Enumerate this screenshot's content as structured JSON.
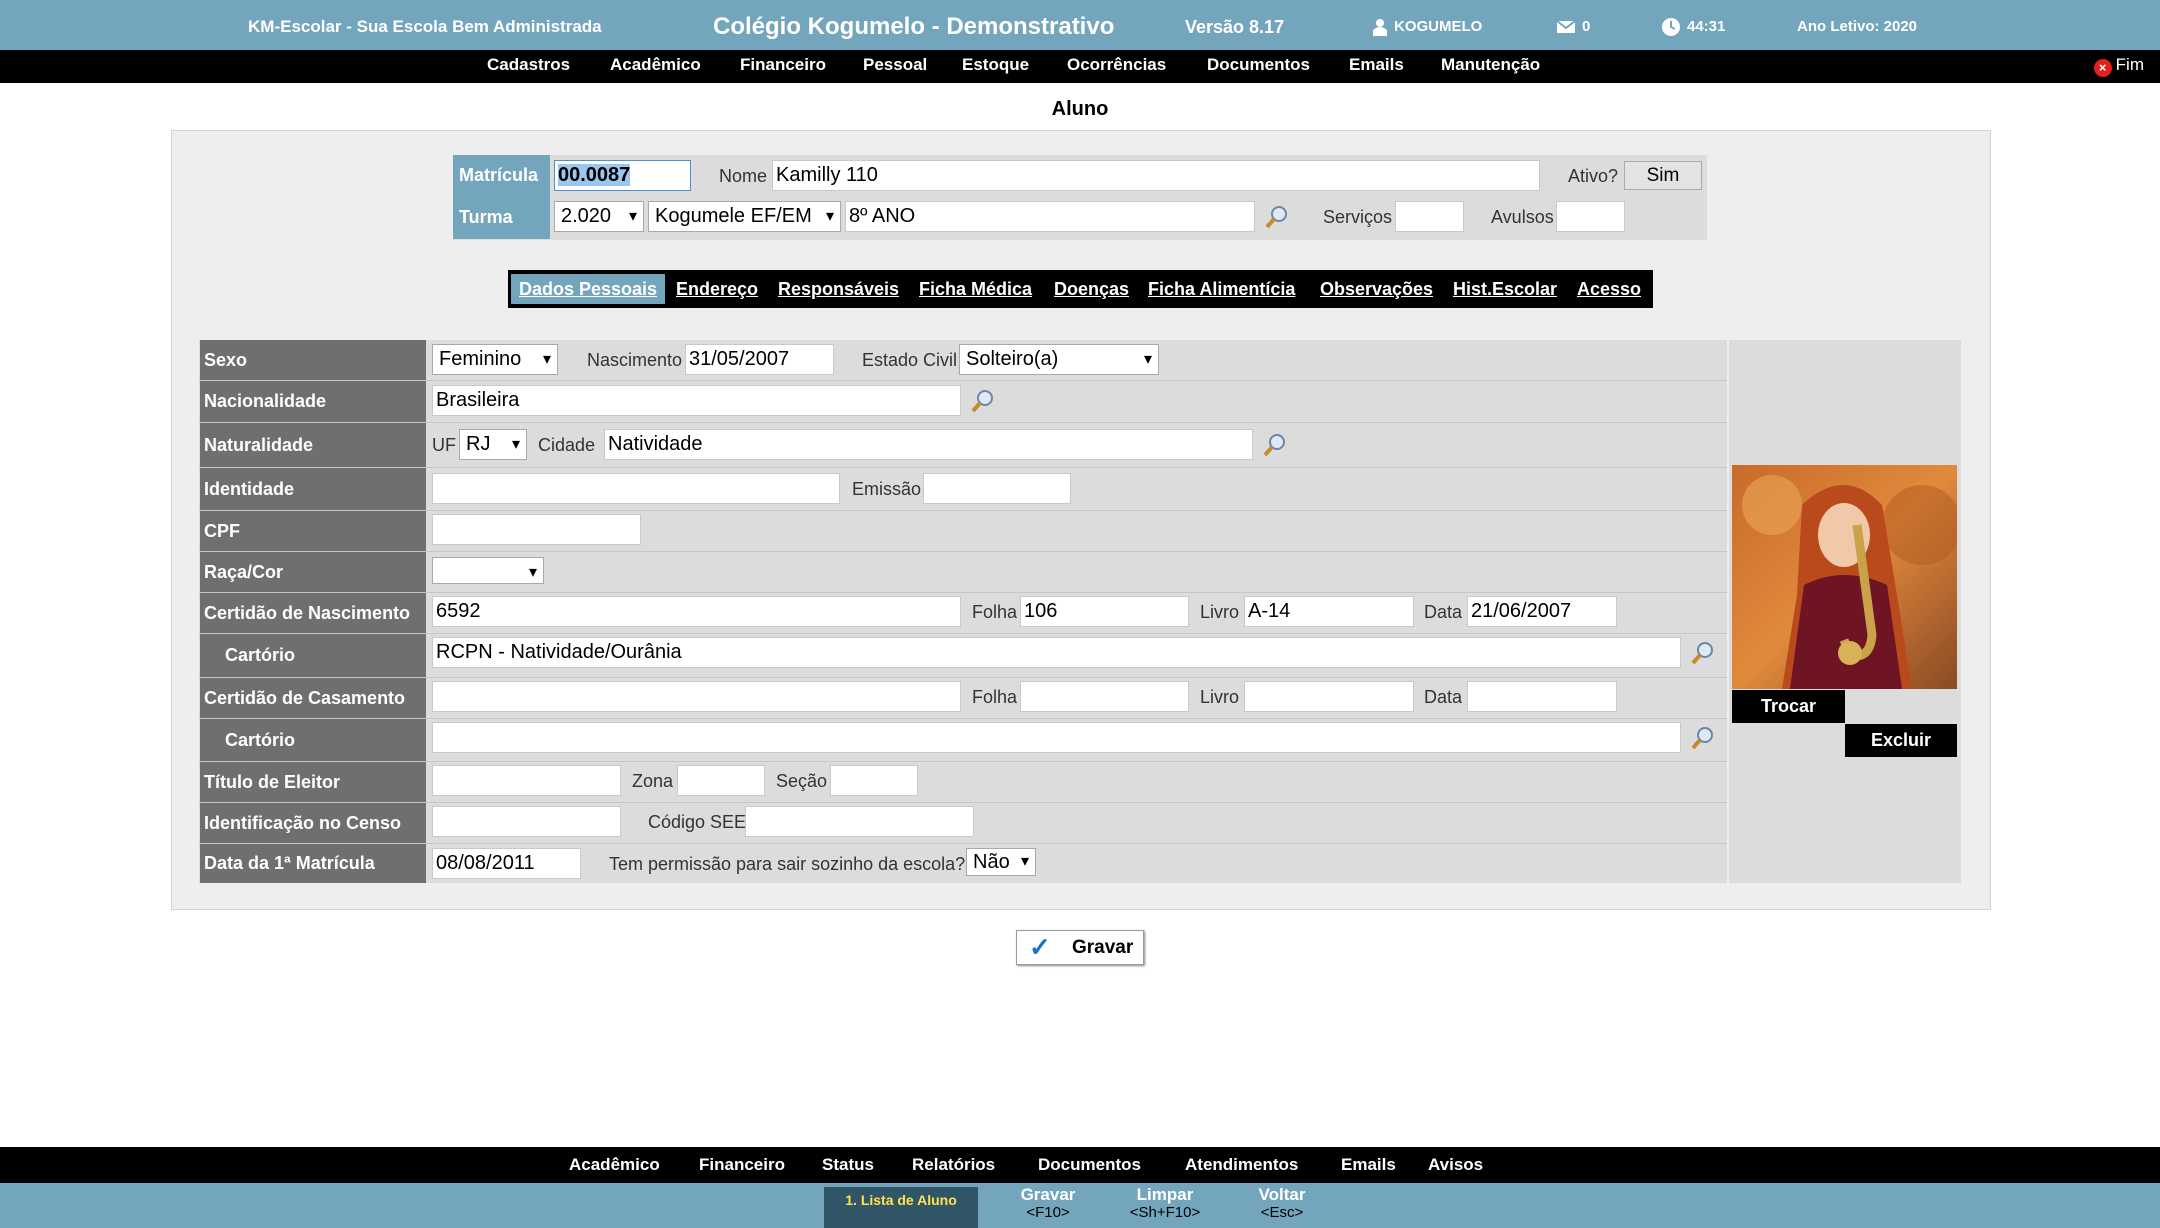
{
  "topbar": {
    "system_name": "KM-Escolar - Sua Escola Bem Administrada",
    "school_name": "Colégio Kogumelo - Demonstrativo",
    "version": "Versão 8.17",
    "user": "KOGUMELO",
    "messages_count": "0",
    "timer": "44:31",
    "school_year": "Ano Letivo: 2020"
  },
  "menu": {
    "items": [
      "Cadastros",
      "Acadêmico",
      "Financeiro",
      "Pessoal",
      "Estoque",
      "Ocorrências",
      "Documentos",
      "Emails",
      "Manutenção"
    ],
    "exit_label": "Fim"
  },
  "page_title": "Aluno",
  "header": {
    "matricula_label": "Matrícula",
    "matricula_value": "00.0087",
    "nome_label": "Nome",
    "nome_value": "Kamilly 110",
    "ativo_label": "Ativo?",
    "ativo_value": "Sim",
    "turma_label": "Turma",
    "year_value": "2.020",
    "unit_value": "Kogumele EF/EM",
    "class_value": "8º ANO",
    "servicos_label": "Serviços",
    "avulsos_label": "Avulsos"
  },
  "tabs": [
    "Dados Pessoais",
    "Endereço",
    "Responsáveis",
    "Ficha Médica",
    "Doenças",
    "Ficha Alimentícia",
    "Observações",
    "Hist.Escolar",
    "Acesso"
  ],
  "form": {
    "sexo": {
      "label": "Sexo",
      "value": "Feminino"
    },
    "nascimento": {
      "label": "Nascimento",
      "value": "31/05/2007"
    },
    "estado_civil": {
      "label": "Estado Civil",
      "value": "Solteiro(a)"
    },
    "nacionalidade": {
      "label": "Nacionalidade",
      "value": "Brasileira"
    },
    "naturalidade": {
      "label": "Naturalidade",
      "uf_label": "UF",
      "uf_value": "RJ",
      "cidade_label": "Cidade",
      "cidade_value": "Natividade"
    },
    "identidade": {
      "label": "Identidade",
      "emissao_label": "Emissão"
    },
    "cpf": {
      "label": "CPF"
    },
    "raca": {
      "label": "Raça/Cor"
    },
    "certidao_nasc": {
      "label": "Certidão de Nascimento",
      "value": "6592",
      "folha_label": "Folha",
      "folha_value": "106",
      "livro_label": "Livro",
      "livro_value": "A-14",
      "data_label": "Data",
      "data_value": "21/06/2007"
    },
    "cartorio_nasc": {
      "label": "Cartório",
      "value": "RCPN - Natividade/Ourânia"
    },
    "certidao_cas": {
      "label": "Certidão de Casamento",
      "folha_label": "Folha",
      "livro_label": "Livro",
      "data_label": "Data"
    },
    "cartorio_cas": {
      "label": "Cartório"
    },
    "titulo": {
      "label": "Título de Eleitor",
      "zona_label": "Zona",
      "secao_label": "Seção"
    },
    "censo": {
      "label": "Identificação no Censo",
      "codigo_label": "Código SEE"
    },
    "primeira_matricula": {
      "label": "Data da 1ª Matrícula",
      "value": "08/08/2011",
      "permissao_label": "Tem permissão para sair sozinho da escola?",
      "permissao_value": "Não"
    }
  },
  "photo": {
    "trocar_label": "Trocar",
    "excluir_label": "Excluir"
  },
  "gravar_label": "Gravar",
  "bottom_menu": [
    "Acadêmico",
    "Financeiro",
    "Status",
    "Relatórios",
    "Documentos",
    "Atendimentos",
    "Emails",
    "Avisos"
  ],
  "function_keys": [
    {
      "label": "1. Lista de Aluno",
      "key": ""
    },
    {
      "label": "Gravar",
      "key": "<F10>"
    },
    {
      "label": "Limpar",
      "key": "<Sh+F10>"
    },
    {
      "label": "Voltar",
      "key": "<Esc>"
    }
  ],
  "colors": {
    "accent": "#73a6bd",
    "label_gray": "#6f6f6f",
    "menu_black": "#000000"
  }
}
